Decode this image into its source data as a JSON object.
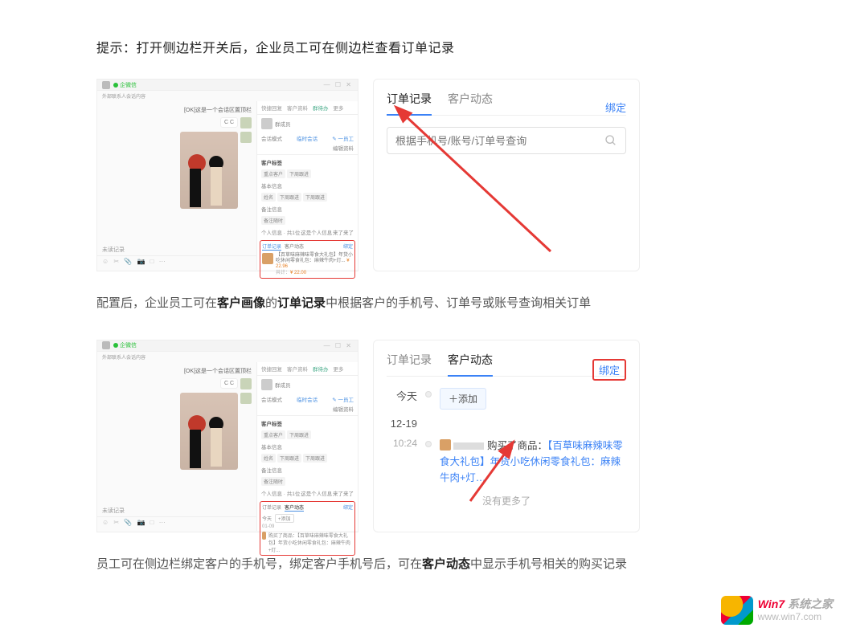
{
  "tip": "提示：打开侧边栏开关后，企业员工可在侧边栏查看订单记录",
  "desc1_pre": "配置后，企业员工可在",
  "desc1_b1": "客户画像",
  "desc1_mid": "的",
  "desc1_b2": "订单记录",
  "desc1_post": "中根据客户的手机号、订单号或账号查询相关订单",
  "desc2_pre": "员工可在侧边栏绑定客户的手机号，绑定客户手机号后，可在",
  "desc2_b": "客户动态",
  "desc2_post": "中显示手机号相关的购买记录",
  "chat": {
    "app": "企微信",
    "subtitle": "外部联系人会话内容",
    "title": "[OK]这是一个会话区置顶栏",
    "msg": "C C",
    "unread": "未读记录",
    "tabs": [
      "快捷回复",
      "客户资料",
      "群待办",
      "更多"
    ],
    "who_name": "群成员",
    "mode": "会话模式",
    "mode_v": "临时会话",
    "edit": "编辑资料",
    "num": "✎ 一员工",
    "head1": "客户标签",
    "tags1": [
      "重点客户",
      "下周跟进"
    ],
    "head2": "基本信息",
    "tags2": [
      "姓名",
      "下周跟进",
      "下周跟进"
    ],
    "head3": "备注信息",
    "tags3": [
      "备注随时"
    ],
    "head4_pre": "个人信息 · 共1位",
    "head4_mid": "这是个人信息",
    "head4_post": "来了来了",
    "order_tab1": "订单记录",
    "order_tab2": "客户动态",
    "bind": "绑定",
    "order_text": "【百草味麻辣味零食大礼包】年货小吃休闲零食礼包：麻辣牛肉+灯...",
    "price1": "¥ 22.96",
    "price2": "¥ 22.00",
    "feed_tab1": "订单记录",
    "feed_tab2": "客户动态",
    "today": "今天",
    "add": "+添加",
    "date2": "01-09",
    "feed_txt": "购买了商品：【百草味麻辣味零食大礼包】年货小吃休闲零食礼包：麻辣牛肉+灯..."
  },
  "rp1": {
    "tab1": "订单记录",
    "tab2": "客户动态",
    "bind": "绑定",
    "placeholder": "根据手机号/账号/订单号查询"
  },
  "rp2": {
    "tab1": "订单记录",
    "tab2": "客户动态",
    "bind": "绑定",
    "today": "今天",
    "add": "＋添加",
    "date": "12-19",
    "time": "10:24",
    "buy_pre": "购买了商品：",
    "buy_link": "【百草味麻辣味零食大礼包】年货小吃休闲零食礼包：麻辣牛肉+灯…",
    "nomore": "没有更多了"
  },
  "watermark": {
    "brand": "Win7",
    "suffix": "系统之家",
    "url": "www.win7.com"
  }
}
